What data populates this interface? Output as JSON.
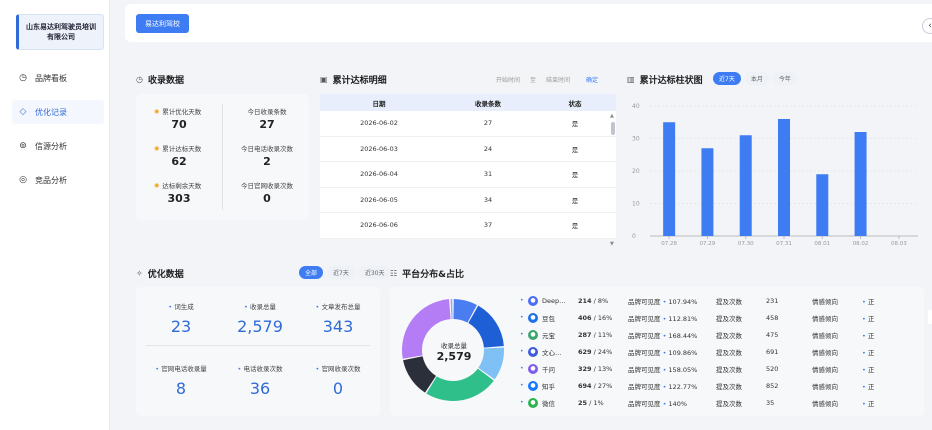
{
  "sidebar": {
    "company": "山东易达利驾驶员培训有限公司",
    "items": [
      {
        "label": "品牌看板",
        "icon": "dashboard-icon"
      },
      {
        "label": "优化记录",
        "icon": "diamond-icon"
      },
      {
        "label": "信源分析",
        "icon": "signal-icon"
      },
      {
        "label": "竞品分析",
        "icon": "target-icon"
      }
    ]
  },
  "topbar": {
    "tab_label": "易达利驾校",
    "collapse": "‹"
  },
  "collect": {
    "title": "收录数据",
    "left": [
      {
        "label": "累计优化天数",
        "value": "70"
      },
      {
        "label": "累计达标天数",
        "value": "62"
      },
      {
        "label": "达标剩余天数",
        "value": "303"
      }
    ],
    "right": [
      {
        "label": "今日收录条数",
        "value": "27"
      },
      {
        "label": "今日电话收录次数",
        "value": "2"
      },
      {
        "label": "今日官网收录次数",
        "value": "0"
      }
    ]
  },
  "detail": {
    "title": "累计达标明细",
    "date_start": "开始时间",
    "date_sep": "至",
    "date_end": "结束时间",
    "confirm": "确定",
    "headers": [
      "日期",
      "收录条数",
      "状态"
    ],
    "rows": [
      [
        "2026-06-02",
        "27",
        "是"
      ],
      [
        "2026-06-03",
        "24",
        "是"
      ],
      [
        "2026-06-04",
        "31",
        "是"
      ],
      [
        "2026-06-05",
        "34",
        "是"
      ],
      [
        "2026-06-06",
        "37",
        "是"
      ]
    ]
  },
  "bar_section": {
    "title": "累计达标柱状图",
    "pills": [
      "近7天",
      "本月",
      "今年"
    ],
    "active_pill": 0,
    "colors": {
      "bar": "#3d7cf2",
      "axis": "#999999",
      "grid": "#e8e8e8"
    }
  },
  "chart_data": {
    "type": "bar",
    "categories": [
      "07.28",
      "07.29",
      "07.30",
      "07.31",
      "08.01",
      "08.02",
      "08.03"
    ],
    "values": [
      35,
      27,
      31,
      36,
      19,
      32,
      0
    ],
    "ylim": [
      0,
      40
    ],
    "yticks": [
      0,
      10,
      20,
      30,
      40
    ],
    "grid": true
  },
  "optimize": {
    "title": "优化数据",
    "pills": [
      "全部",
      "近7天",
      "近30天"
    ],
    "active_pill": 0,
    "stats": [
      {
        "label": "词生成",
        "value": "23"
      },
      {
        "label": "收录总量",
        "value": "2,579"
      },
      {
        "label": "文章发布总量",
        "value": "343"
      },
      {
        "label": "官网电话收录量",
        "value": "8"
      },
      {
        "label": "电话收录次数",
        "value": "36"
      },
      {
        "label": "官网收录次数",
        "value": "0"
      }
    ]
  },
  "platform": {
    "title": "平台分布&占比",
    "center_label": "收录总量",
    "center_value": "2,579",
    "vis_label": "品牌可见度",
    "mention_label": "提及次数",
    "sentiment_label": "情感倾向",
    "rows": [
      {
        "name": "Deep…",
        "count": "214",
        "pct": "8%",
        "vis": "107.94%",
        "mentions": "231",
        "sentiment": "正",
        "color": "#4a6cf7",
        "icon": "deepseek-icon",
        "share": 8
      },
      {
        "name": "豆包",
        "count": "406",
        "pct": "16%",
        "vis": "112.81%",
        "mentions": "458",
        "sentiment": "正",
        "color": "#1e6fe8",
        "icon": "doubao-icon",
        "share": 16
      },
      {
        "name": "元宝",
        "count": "287",
        "pct": "11%",
        "vis": "168.44%",
        "mentions": "475",
        "sentiment": "正",
        "color": "#3aa66e",
        "icon": "yuanbao-icon",
        "share": 11
      },
      {
        "name": "文心…",
        "count": "629",
        "pct": "24%",
        "vis": "109.86%",
        "mentions": "691",
        "sentiment": "正",
        "color": "#3f5bd9",
        "icon": "wenxin-icon",
        "share": 24
      },
      {
        "name": "千问",
        "count": "329",
        "pct": "13%",
        "vis": "158.05%",
        "mentions": "520",
        "sentiment": "正",
        "color": "#7e5cf0",
        "icon": "qianwen-icon",
        "share": 13
      },
      {
        "name": "知乎",
        "count": "694",
        "pct": "27%",
        "vis": "122.77%",
        "mentions": "852",
        "sentiment": "正",
        "color": "#1677ff",
        "icon": "zhihu-icon",
        "share": 27
      },
      {
        "name": "微信",
        "count": "25",
        "pct": "1%",
        "vis": "140%",
        "mentions": "35",
        "sentiment": "正",
        "color": "#2bb24c",
        "icon": "wechat-icon",
        "share": 1
      }
    ],
    "donut_colors": [
      "#4a7df0",
      "#1f5fd6",
      "#7fc0f5",
      "#2fbf8a",
      "#2b2f3a",
      "#b47cf5",
      "#8fa8f0"
    ],
    "donut_order": [
      0,
      1,
      2,
      3,
      4,
      5,
      6
    ]
  }
}
